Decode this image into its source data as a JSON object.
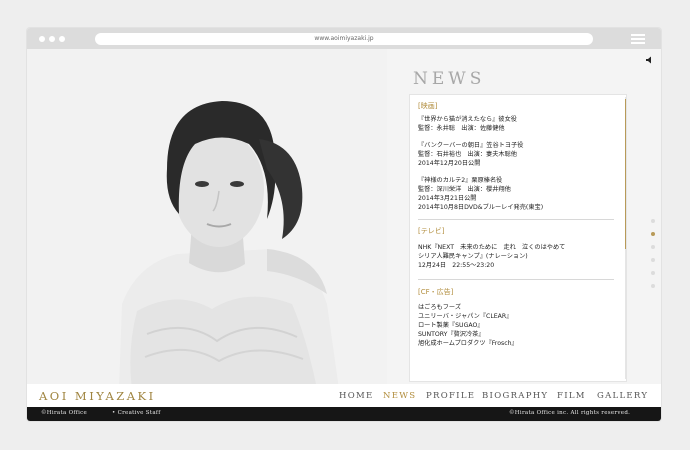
{
  "browser": {
    "url": "www.aoimiyazaki.jp"
  },
  "news": {
    "title": "NEWS",
    "sections": [
      {
        "category": "[映画]",
        "lines": [
          "『世界から猫が消えたなら』彼女役",
          "監督：永井聡　出演：佐藤健他",
          "『バンクーバーの朝日』笠谷トヨ子役",
          "監督：石井裕也　出演：妻夫木聡他",
          "2014年12月20日公開",
          "『神様のカルテ2』栗原榛名役",
          "監督：深川栄洋　出演：櫻井翔他",
          "2014年3月21日公開",
          "2014年10月8日DVD&ブルーレイ発売(東宝)"
        ]
      },
      {
        "category": "[テレビ]",
        "lines": [
          "NHK『NEXT　未来のために　走れ　泣くのはやめて",
          "シリア人難民キャンプ』(ナレーション)",
          "12月24日　22:55〜23:20"
        ]
      },
      {
        "category": "[CF・広告]",
        "lines": [
          "はごろもフーズ",
          "ユニリーバ・ジャパン『CLEAR』",
          "ロート製薬『SUGAO』",
          "SUNTORY『贅沢冷茶』",
          "旭化成ホームプロダクツ『Frosch』"
        ]
      }
    ]
  },
  "nav": {
    "logo": "AOI MIYAZAKI",
    "items": [
      "HOME",
      "NEWS",
      "PROFILE",
      "BIOGRAPHY",
      "FILM",
      "GALLERY"
    ],
    "active": "NEWS"
  },
  "footer": {
    "left1": "©Hirata Office",
    "left2": "• Creative Staff",
    "right": "©Hirata Office inc. All rights reserved."
  },
  "colors": {
    "accent": "#b89a58",
    "footer_bg": "#161616",
    "chrome": "#dcdcdc"
  },
  "photo": {
    "alt": "monochrome portrait photo",
    "icon": "portrait-photo"
  }
}
